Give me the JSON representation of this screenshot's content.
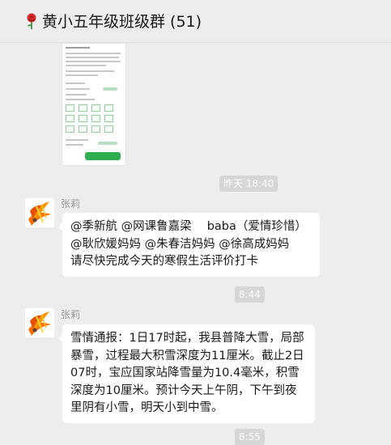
{
  "header": {
    "title": "黄小五年级班级群 (51)"
  },
  "messages": [
    {
      "timestamp": "昨天 18:40",
      "sender": "张莉",
      "text": "@季新航 @网课鲁嘉梁　 baba（爱情珍惜）@耿欣媛妈妈 @朱春洁妈妈 @徐高成妈妈　 请尽快完成今天的寒假生活评价打卡"
    },
    {
      "timestamp": "8:44",
      "sender": "张莉",
      "text": "雪情通报：1日17时起，我县普降大雪，局部暴雪，过程最大积雪深度为11厘米。截止2日07时，宝应国家站降雪量为10.4毫米，积雪深度为10厘米。预计今天上午阴，下午到夜里阴有小雪，明天小到中雪。"
    }
  ],
  "footer_timestamp": "8:55",
  "colors": {
    "background": "#ededed",
    "bubble": "#ffffff",
    "timestamp_bg": "#d6d6d6",
    "accent_green": "#2fae4f"
  }
}
